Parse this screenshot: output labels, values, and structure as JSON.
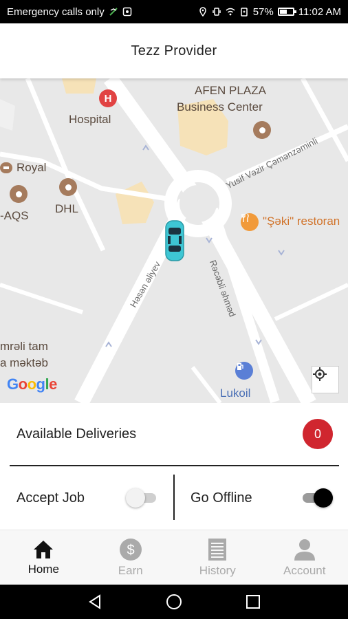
{
  "status_bar": {
    "carrier": "Emergency calls only",
    "battery": "57%",
    "battery_level": 0.57,
    "time": "11:02 AM"
  },
  "app_bar": {
    "title": "Tezz Provider"
  },
  "map": {
    "labels": {
      "hospital": "Hospital",
      "afen_line1": "AFEN PLAZA",
      "afen_line2": "Business Center",
      "royal": "Royal",
      "aqs": "-AQS",
      "dhl": "DHL",
      "seki": "\"Şəki\" restoran",
      "yusif": "Yusif Vəzir Çəmənzəminli",
      "hesen": "Həsən əliyev",
      "recebli": "Rəcəbli əhməd",
      "emreli1": "mrəli tam",
      "emreli2": "a məktəb",
      "lukoil": "Lukoil"
    },
    "google": [
      "G",
      "o",
      "o",
      "g",
      "l",
      "e"
    ],
    "google_colors": [
      "#4285F4",
      "#EA4335",
      "#FBBC05",
      "#4285F4",
      "#34A853",
      "#EA4335"
    ],
    "icons": {
      "hospital_poi": "H",
      "restaurant_poi": "fork-knife-icon",
      "fuel_poi": "fuel-icon",
      "locate": "crosshair-icon",
      "car": "car-icon"
    }
  },
  "deliveries": {
    "label": "Available Deliveries",
    "count": "0",
    "badge_color": "#d0262f"
  },
  "toggles": {
    "accept_job": {
      "label": "Accept Job",
      "on": false
    },
    "go_offline": {
      "label": "Go Offline",
      "on": true
    }
  },
  "bottom_nav": [
    {
      "label": "Home",
      "icon": "home-icon",
      "active": true
    },
    {
      "label": "Earn",
      "icon": "dollar-icon",
      "active": false
    },
    {
      "label": "History",
      "icon": "history-icon",
      "active": false
    },
    {
      "label": "Account",
      "icon": "account-icon",
      "active": false
    }
  ],
  "earn_symbol": "$",
  "colors": {
    "accent": "#d0262f",
    "car": "#3ec6d4",
    "map_road": "#ffffff",
    "map_bg": "#e8e8e8"
  }
}
